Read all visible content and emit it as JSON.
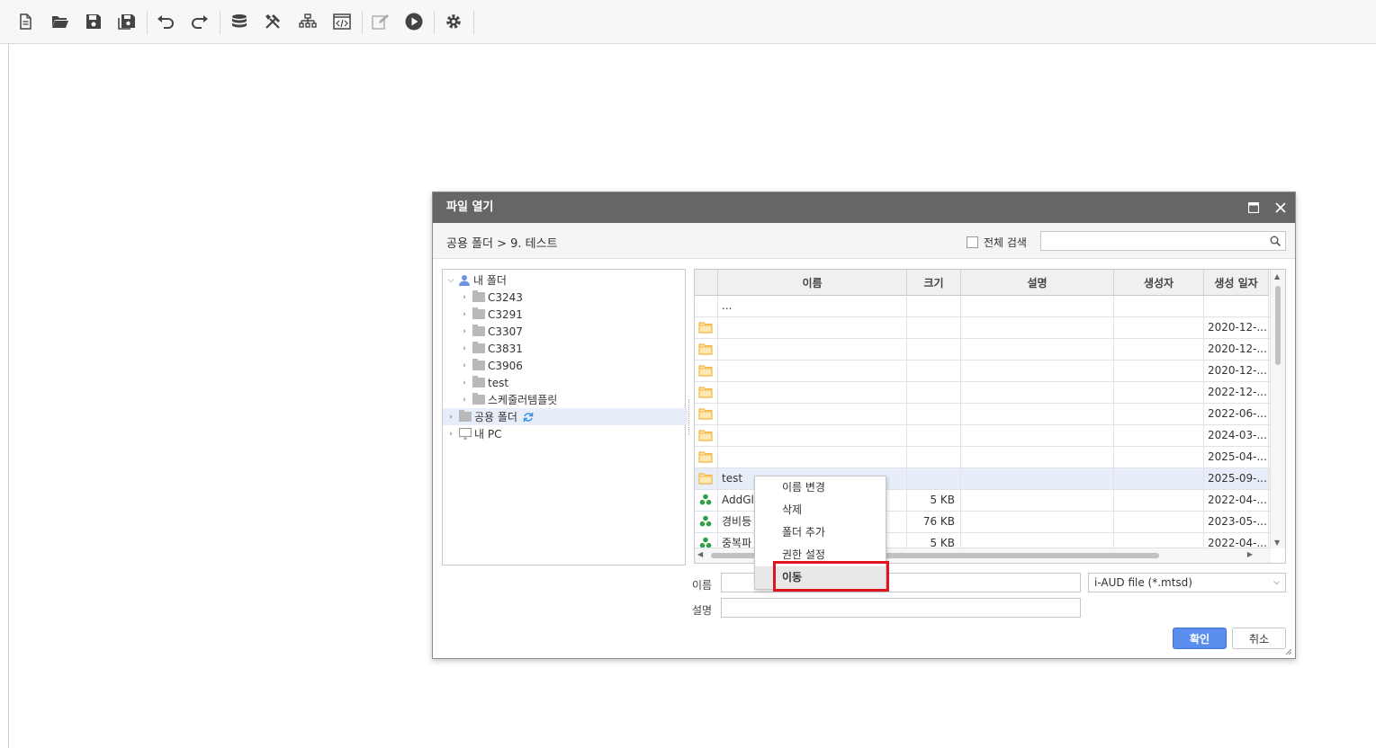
{
  "toolbar": {
    "buttons": [
      "new-document-icon",
      "open-folder-icon",
      "save-icon",
      "save-as-icon",
      "undo-icon",
      "redo-icon",
      "database-icon",
      "tools-icon",
      "hierarchy-icon",
      "code-icon",
      "edit-icon",
      "run-icon",
      "settings-icon"
    ]
  },
  "dialog": {
    "title": "파일 열기",
    "path": "공용 폴더 > 9. 테스트",
    "all_search_label": "전체 검색",
    "search_placeholder": ""
  },
  "tree": {
    "root_my_folder": "내 폴더",
    "children": [
      "C3243",
      "C3291",
      "C3307",
      "C3831",
      "C3906",
      "test",
      "스케줄러템플릿"
    ],
    "shared_folder": "공용 폴더",
    "my_pc": "내 PC"
  },
  "grid": {
    "headers": [
      "이름",
      "크기",
      "설명",
      "생성자",
      "생성 일자"
    ],
    "up_row": "...",
    "rows": [
      {
        "type": "folder",
        "name": "",
        "size": "",
        "desc": "",
        "creator": "",
        "date": "2020-12-..."
      },
      {
        "type": "folder",
        "name": "",
        "size": "",
        "desc": "",
        "creator": "",
        "date": "2020-12-..."
      },
      {
        "type": "folder",
        "name": "",
        "size": "",
        "desc": "",
        "creator": "",
        "date": "2020-12-..."
      },
      {
        "type": "folder",
        "name": "",
        "size": "",
        "desc": "",
        "creator": "",
        "date": "2022-12-..."
      },
      {
        "type": "folder",
        "name": "",
        "size": "",
        "desc": "",
        "creator": "",
        "date": "2022-06-..."
      },
      {
        "type": "folder",
        "name": "",
        "size": "",
        "desc": "",
        "creator": "",
        "date": "2024-03-..."
      },
      {
        "type": "folder",
        "name": "",
        "size": "",
        "desc": "",
        "creator": "",
        "date": "2025-04-..."
      },
      {
        "type": "folder",
        "name": "test",
        "size": "",
        "desc": "",
        "creator": "",
        "date": "2025-09-..."
      },
      {
        "type": "file",
        "name": "AddGl",
        "size": "5 KB",
        "desc": "",
        "creator": "",
        "date": "2022-04-..."
      },
      {
        "type": "file",
        "name": "경비등",
        "size": "76 KB",
        "desc": "",
        "creator": "",
        "date": "2023-05-..."
      },
      {
        "type": "file",
        "name": "중복파",
        "size": "5 KB",
        "desc": "",
        "creator": "",
        "date": "2022-04-..."
      }
    ]
  },
  "form": {
    "name_label": "이름",
    "name_value": "",
    "desc_label": "설명",
    "desc_value": "",
    "file_type": "i-AUD file (*.mtsd)"
  },
  "buttons": {
    "ok": "확인",
    "cancel": "취소"
  },
  "context_menu": {
    "items": [
      "이름 변경",
      "삭제",
      "폴더 추가",
      "권한 설정",
      "이동"
    ],
    "highlighted": "이동"
  },
  "colors": {
    "title_bar": "#666666",
    "primary_button": "#5b8def",
    "highlight_border": "#e0141e",
    "folder": "#f5b53d",
    "file_icon": "#2f9e44"
  }
}
